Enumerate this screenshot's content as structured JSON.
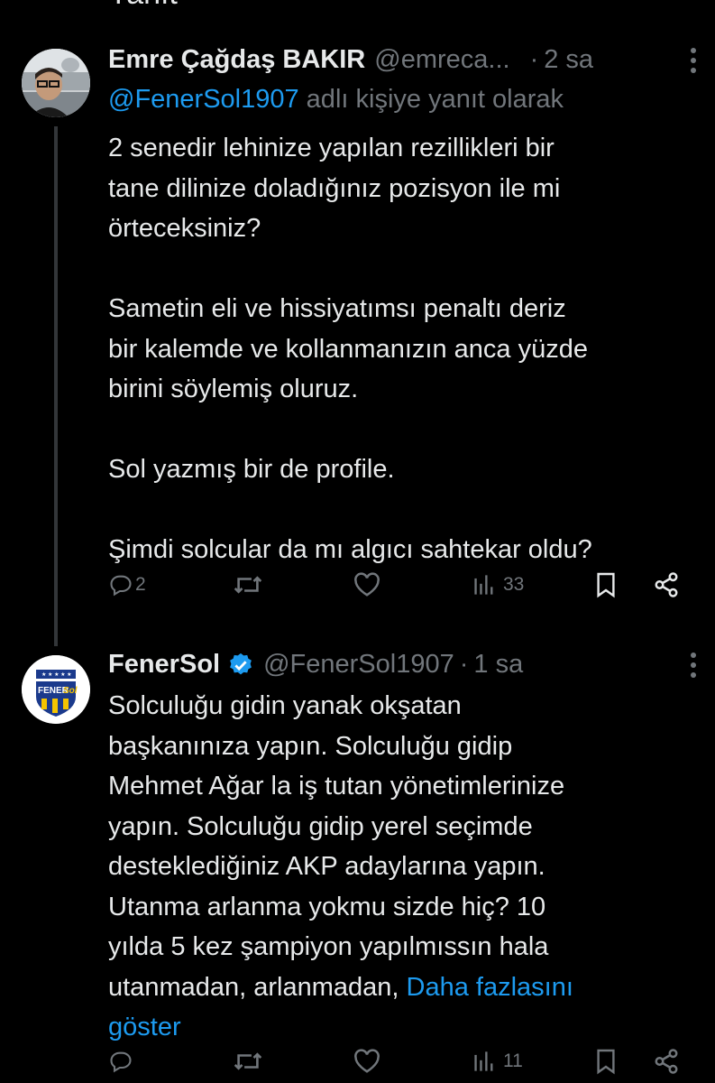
{
  "top_cut_text": "Yanıt",
  "tweets": [
    {
      "display_name": "Emre Çağdaş BAKIR",
      "handle": "@emreca...",
      "separator": "·",
      "time": "2 sa",
      "more_icon": "more-vertical-icon",
      "replying_handle": "@FenerSol1907",
      "replying_suffix": " adlı kişiye yanıt olarak",
      "body": "2 senedir lehinize yapılan rezillikleri bir\ntane dilinize doladığınız pozisyon ile mi\nörteceksiniz?\n\nSametin eli ve hissiyatımsı penaltı deriz\nbir kalemde ve kollanmanızın anca yüzde\nbirini söylemiş oluruz.\n\nSol yazmış bir de profile.\n\nŞimdi solcular da mı algıcı sahtekar oldu?",
      "reply_count": "2",
      "view_count": "33"
    },
    {
      "display_name": "FenerSol",
      "verified": true,
      "handle": "@FenerSol1907",
      "separator": "·",
      "time": "1 sa",
      "body": "Solculuğu gidin yanak okşatan\nbaşkanınıza yapın. Solculuğu gidip\nMehmet Ağar la iş tutan yönetimlerinize\nyapın. Solculuğu gidip yerel seçimde\ndesteklediğiniz AKP adaylarına yapın.\nUtanma arlanma yokmu sizde hiç? 10\nyılda 5 kez şampiyon yapılmıssın hala\nutanmadan, arlanmadan, ",
      "show_more": "Daha fazlasını\ngöster",
      "view_count": "11",
      "avatar_text": "FENER Sol"
    }
  ],
  "colors": {
    "background": "#000000",
    "text": "#e7e9ea",
    "muted": "#71767b",
    "link": "#1d9bf0",
    "verified": "#1d9bf0"
  }
}
